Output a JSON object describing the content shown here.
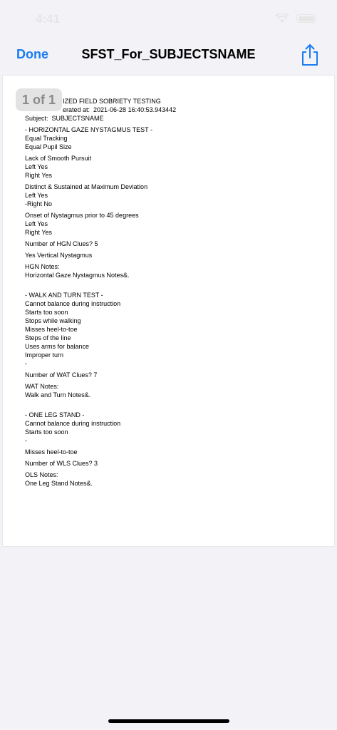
{
  "status": {
    "time": "4:41"
  },
  "nav": {
    "done_label": "Done",
    "title": "SFST_For_SUBJECTSNAME"
  },
  "viewer": {
    "page_indicator": "1 of 1"
  },
  "document": {
    "title": "IZED FIELD SOBRIETY TESTING",
    "generated": "erated at:  2021-06-28 16:40:53.943442",
    "subject": "Subject:  SUBJECTSNAME",
    "hgn": {
      "heading": "- HORIZONTAL GAZE NYSTAGMUS TEST -",
      "equal_tracking": "Equal Tracking",
      "equal_pupil": "Equal Pupil Size",
      "smooth_pursuit": "Lack of Smooth Pursuit",
      "sp_left": "Left Yes",
      "sp_right": "Right Yes",
      "max_deviation": "Distinct & Sustained at Maximum Deviation",
      "md_left": "Left Yes",
      "md_right": "-Right No",
      "onset": "Onset of Nystagmus prior to 45 degrees",
      "on_left": "Left Yes",
      "on_right": "Right Yes",
      "clues": "Number of HGN Clues? 5",
      "vertical": "Yes Vertical Nystagmus",
      "notes_label": "HGN Notes:",
      "notes": "Horizontal Gaze Nystagmus Notes&."
    },
    "wat": {
      "heading": "- WALK AND TURN TEST -",
      "items": [
        "Cannot balance during instruction",
        "Starts too soon",
        "Stops while walking",
        "Misses heel-to-toe",
        "Steps of the line",
        "Uses arms for balance",
        "Improper turn",
        "-"
      ],
      "clues": "Number of WAT Clues? 7",
      "notes_label": "WAT Notes:",
      "notes": "Walk and Turn Notes&."
    },
    "ols": {
      "heading": "- ONE LEG STAND -",
      "items": [
        "Cannot balance during instruction",
        "Starts too soon",
        "-"
      ],
      "misses": "Misses heel-to-toe",
      "clues": "Number of WLS Clues? 3",
      "notes_label": "OLS Notes:",
      "notes": "One Leg Stand Notes&."
    }
  }
}
